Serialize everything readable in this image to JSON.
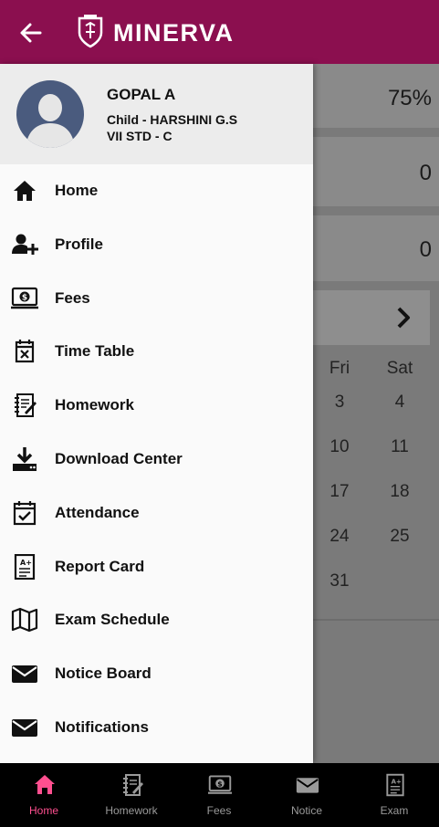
{
  "header": {
    "title": "MINERVA",
    "back_icon": "arrow-left-icon",
    "logo_icon": "minerva-crest-icon",
    "background_color": "#8b0f4f"
  },
  "background": {
    "stats": [
      "75%",
      "0",
      "0"
    ],
    "calendar": {
      "weekdays": [
        "Fri",
        "Sat"
      ],
      "rows": [
        [
          "3",
          "4"
        ],
        [
          "10",
          "11"
        ],
        [
          "17",
          "18"
        ],
        [
          "24",
          "25"
        ],
        [
          "31",
          ""
        ]
      ]
    }
  },
  "drawer": {
    "user": {
      "name": "GOPAL A",
      "child": "Child - HARSHINI G.S",
      "class": "VII STD - C"
    },
    "menu": [
      {
        "label": "Home",
        "icon": "home-icon"
      },
      {
        "label": "Profile",
        "icon": "add-user-icon"
      },
      {
        "label": "Fees",
        "icon": "dollar-screen-icon"
      },
      {
        "label": "Time Table",
        "icon": "calendar-x-icon"
      },
      {
        "label": "Homework",
        "icon": "homework-icon"
      },
      {
        "label": "Download Center",
        "icon": "download-icon"
      },
      {
        "label": "Attendance",
        "icon": "calendar-check-icon"
      },
      {
        "label": "Report Card",
        "icon": "report-card-icon"
      },
      {
        "label": "Exam Schedule",
        "icon": "map-icon"
      },
      {
        "label": "Notice Board",
        "icon": "envelope-icon"
      },
      {
        "label": "Notifications",
        "icon": "envelope-icon"
      }
    ]
  },
  "bottom_nav": {
    "items": [
      {
        "label": "Home",
        "icon": "home-icon",
        "active": true
      },
      {
        "label": "Homework",
        "icon": "homework-icon",
        "active": false
      },
      {
        "label": "Fees",
        "icon": "dollar-screen-icon",
        "active": false
      },
      {
        "label": "Notice",
        "icon": "envelope-icon",
        "active": false
      },
      {
        "label": "Exam",
        "icon": "report-card-icon",
        "active": false
      }
    ],
    "active_color": "#ff4f8f",
    "inactive_color": "#9a9a9a"
  }
}
